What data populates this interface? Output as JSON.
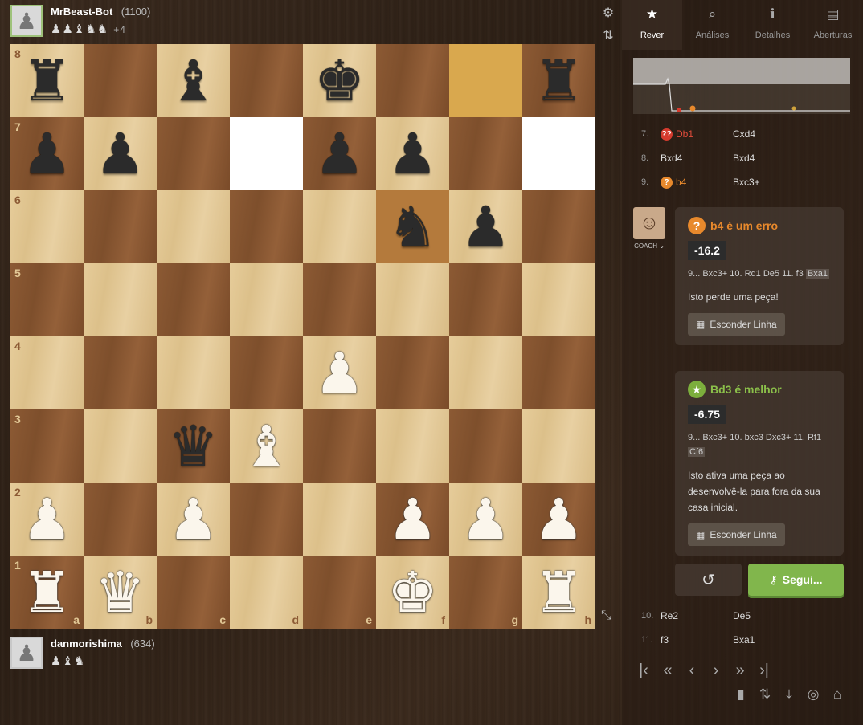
{
  "players": {
    "top": {
      "name": "MrBeast-Bot",
      "rating": "(1100)",
      "captured": "♟♟♝♞♞",
      "advantage": "+4"
    },
    "bottom": {
      "name": "danmorishima",
      "rating": "(634)",
      "captured": "♟♝♞"
    }
  },
  "board": {
    "ranks": [
      "8",
      "7",
      "6",
      "5",
      "4",
      "3",
      "2",
      "1"
    ],
    "files": [
      "a",
      "b",
      "c",
      "d",
      "e",
      "f",
      "g",
      "h"
    ],
    "pieces": [
      [
        "r",
        "",
        "b",
        "",
        "k",
        "",
        "",
        "r"
      ],
      [
        "p",
        "p",
        "",
        "",
        "p",
        "p",
        "",
        ""
      ],
      [
        "",
        "",
        "",
        "",
        "",
        "n",
        "p",
        ""
      ],
      [
        "",
        "",
        "",
        "",
        "",
        "",
        "",
        ""
      ],
      [
        "",
        "",
        "",
        "",
        "P",
        "",
        "",
        ""
      ],
      [
        "",
        "",
        "q",
        "B",
        "",
        "",
        "",
        ""
      ],
      [
        "P",
        "",
        "P",
        "",
        "",
        "P",
        "P",
        "P"
      ],
      [
        "R",
        "Q",
        "",
        "",
        "",
        "K",
        "",
        "R"
      ]
    ],
    "highlights": {
      "white": [
        "d7",
        "h7"
      ],
      "move": [
        "f6",
        "g8"
      ]
    }
  },
  "tabs": [
    {
      "label": "Rever",
      "icon": "★",
      "active": true
    },
    {
      "label": "Análises",
      "icon": "⌕",
      "active": false
    },
    {
      "label": "Detalhes",
      "icon": "ℹ",
      "active": false
    },
    {
      "label": "Aberturas",
      "icon": "▤",
      "active": false
    }
  ],
  "moves_top": [
    {
      "num": "7.",
      "white": "Db1",
      "black": "Cxd4",
      "class": "bad",
      "badge": "??"
    },
    {
      "num": "8.",
      "white": "Bxd4",
      "black": "Bxd4",
      "class": "",
      "badge": ""
    },
    {
      "num": "9.",
      "white": "b4",
      "black": "Bxc3+",
      "class": "mist",
      "badge": "?"
    }
  ],
  "moves_bottom": [
    {
      "num": "10.",
      "white": "Re2",
      "black": "De5"
    },
    {
      "num": "11.",
      "white": "f3",
      "black": "Bxa1"
    }
  ],
  "coach": {
    "label": "COACH ⌄"
  },
  "cards": {
    "mistake": {
      "title": "b4 é um erro",
      "eval": "-16.2",
      "line_prefix": "9... Bxc3+ 10. Rd1 De5 11. f3",
      "line_hl": "Bxa1",
      "desc": "Isto perde uma peça!",
      "hide_label": "Esconder Linha"
    },
    "best": {
      "title": "Bd3 é melhor",
      "eval": "-6.75",
      "line_prefix": "9... Bxc3+ 10. bxc3 Dxc3+ 11. Rf1",
      "line_hl": "Cf6",
      "desc": "Isto ativa uma peça ao desenvolvê-la para fora da sua casa inicial.",
      "hide_label": "Esconder Linha"
    }
  },
  "actions": {
    "next_label": "Segui..."
  },
  "colors": {
    "accent_green": "#81b64c",
    "mistake": "#e8892c",
    "blunder": "#d63b2e"
  }
}
